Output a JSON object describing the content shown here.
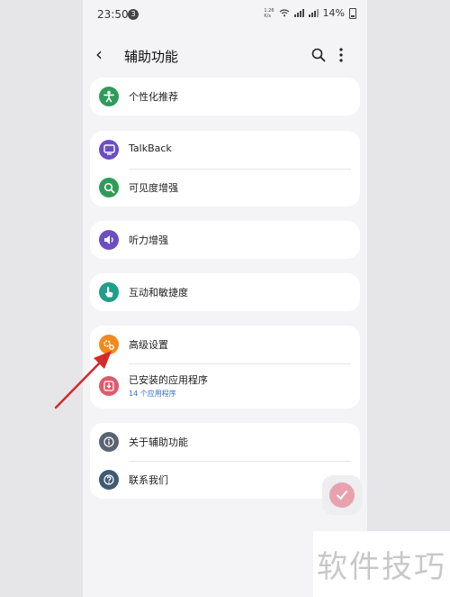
{
  "status_bar": {
    "time": "23:50",
    "notification_badge": "3",
    "network_speed_value": "1.26",
    "network_speed_unit": "K/s",
    "battery": "14%"
  },
  "header": {
    "title": "辅助功能",
    "icons": [
      "back-arrow-icon",
      "search-icon",
      "more-vert-icon"
    ]
  },
  "groups": [
    {
      "items": [
        {
          "label": "个性化推荐",
          "icon": "accessibility-person-icon",
          "color": "#2e9c58"
        }
      ]
    },
    {
      "items": [
        {
          "label": "TalkBack",
          "icon": "talkback-screen-icon",
          "color": "#6b4fc2"
        },
        {
          "label": "可见度增强",
          "icon": "magnifier-icon",
          "color": "#2e9c58"
        }
      ]
    },
    {
      "items": [
        {
          "label": "听力增强",
          "icon": "speaker-icon",
          "color": "#6b4fc2"
        }
      ]
    },
    {
      "items": [
        {
          "label": "互动和敏捷度",
          "icon": "touch-hand-icon",
          "color": "#1f9e8a"
        }
      ]
    },
    {
      "items": [
        {
          "label": "高级设置",
          "icon": "gears-icon",
          "color": "#f08a1c"
        },
        {
          "label": "已安装的应用程序",
          "sub": "14 个应用程序",
          "icon": "download-icon",
          "color": "#e05a6a"
        }
      ]
    },
    {
      "items": [
        {
          "label": "关于辅助功能",
          "icon": "info-icon",
          "color": "#5a6370"
        },
        {
          "label": "联系我们",
          "icon": "question-icon",
          "color": "#3f5a73"
        }
      ]
    }
  ],
  "fab": {
    "icon": "floating-accessibility-button-icon",
    "color": "#e8a2ad"
  },
  "annotation": {
    "icon": "red-pointer-arrow",
    "color": "#d42a2a"
  },
  "watermark": "软件技巧"
}
